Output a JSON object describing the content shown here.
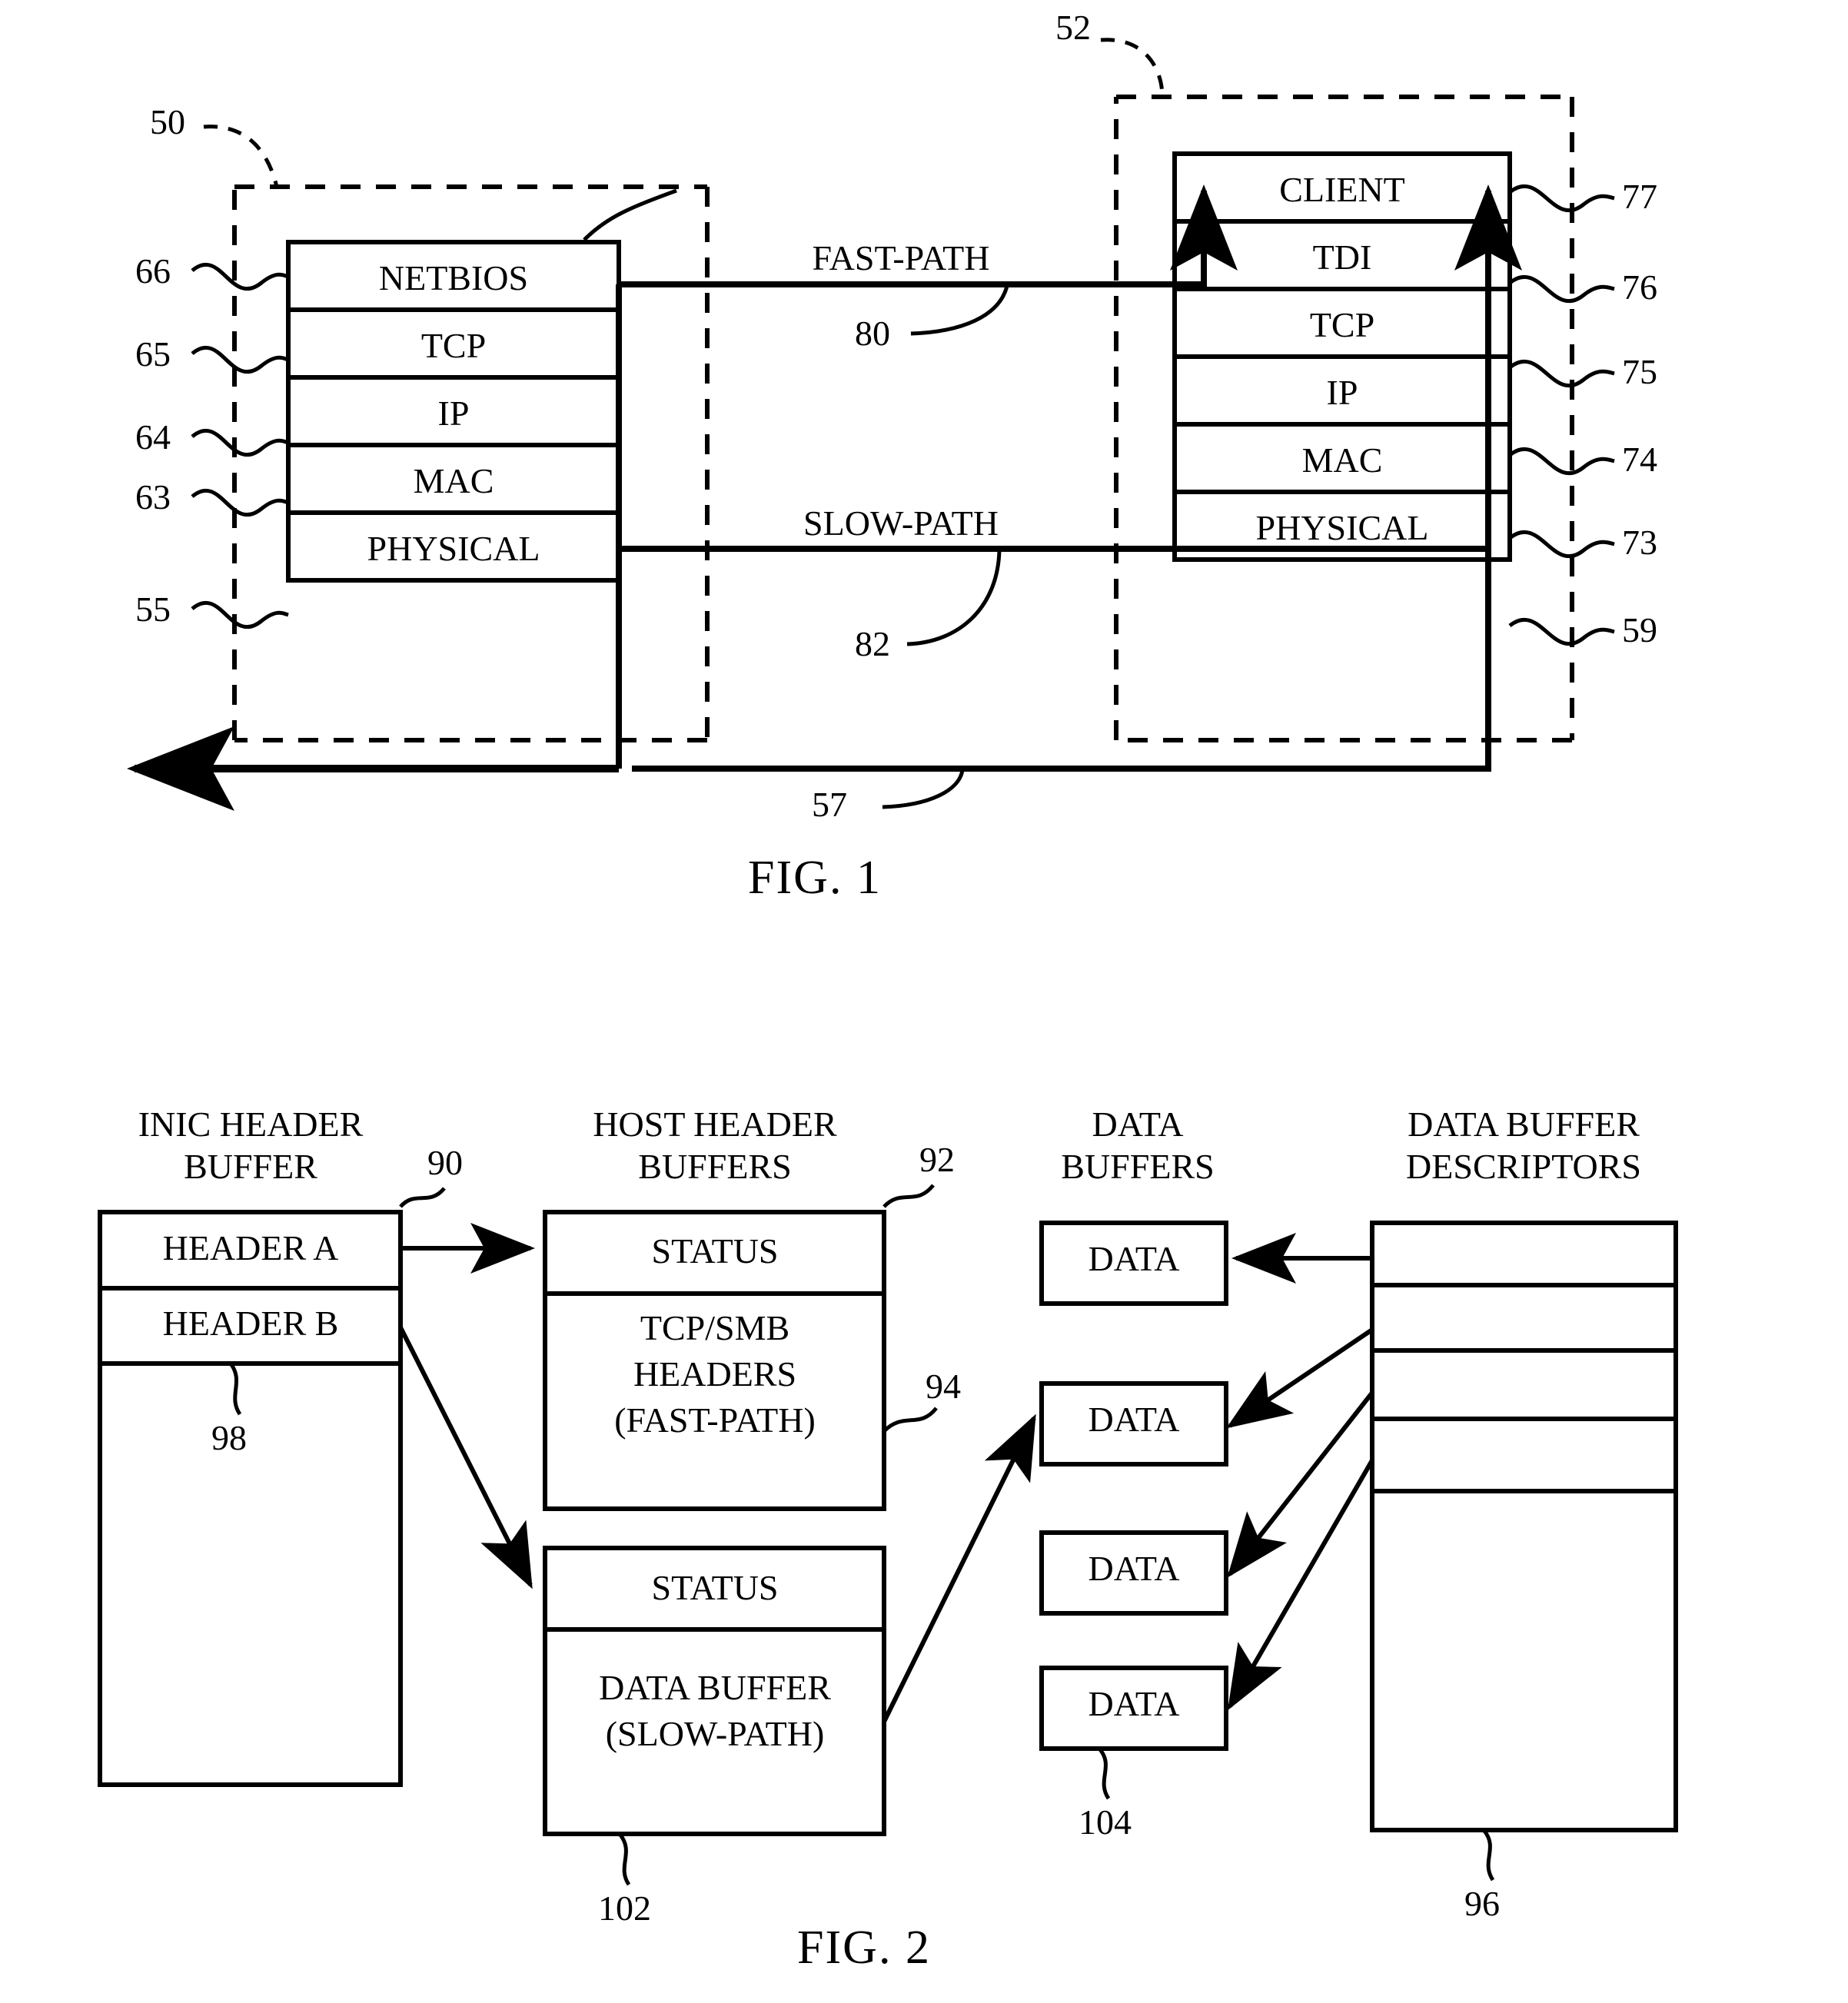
{
  "figures": [
    {
      "id": "fig1",
      "caption": "FIG. 1",
      "left_stack": {
        "title_ref": "50",
        "inner_ref": "57",
        "layers": [
          {
            "label": "NETBIOS",
            "ref": "66"
          },
          {
            "label": "TCP",
            "ref": "65"
          },
          {
            "label": "IP",
            "ref": "64"
          },
          {
            "label": "MAC",
            "ref": "63"
          },
          {
            "label": "PHYSICAL",
            "ref": "55"
          }
        ]
      },
      "right_stack": {
        "title_ref": "52",
        "layers": [
          {
            "label": "CLIENT",
            "ref": "77"
          },
          {
            "label": "TDI",
            "ref": "76"
          },
          {
            "label": "TCP",
            "ref": "75"
          },
          {
            "label": "IP",
            "ref": "74"
          },
          {
            "label": "MAC",
            "ref": "73"
          },
          {
            "label": "PHYSICAL",
            "ref": "59"
          }
        ]
      },
      "paths": [
        {
          "label": "FAST-PATH",
          "ref": "80"
        },
        {
          "label": "SLOW-PATH",
          "ref": "82"
        }
      ]
    },
    {
      "id": "fig2",
      "caption": "FIG. 2",
      "columns": [
        {
          "heading_line1": "INIC HEADER",
          "heading_line2": "BUFFER",
          "ref": "90",
          "inner_ref": "98",
          "rows": [
            "HEADER A",
            "HEADER B"
          ]
        },
        {
          "heading_line1": "HOST HEADER",
          "heading_line2": "BUFFERS",
          "ref": "92",
          "fastpath_ref": "94",
          "slowpath_ref": "102",
          "fastpath_box": {
            "status": "STATUS",
            "body_line1": "TCP/SMB",
            "body_line2": "HEADERS",
            "body_line3": "(FAST-PATH)"
          },
          "slowpath_box": {
            "status": "STATUS",
            "body_line1": "DATA BUFFER",
            "body_line2": "(SLOW-PATH)"
          }
        },
        {
          "heading_line1": "DATA",
          "heading_line2": "BUFFERS",
          "ref": "104",
          "cells": [
            "DATA",
            "DATA",
            "DATA",
            "DATA"
          ]
        },
        {
          "heading_line1": "DATA BUFFER",
          "heading_line2": "DESCRIPTORS",
          "ref": "96",
          "slots": 5
        }
      ]
    }
  ]
}
